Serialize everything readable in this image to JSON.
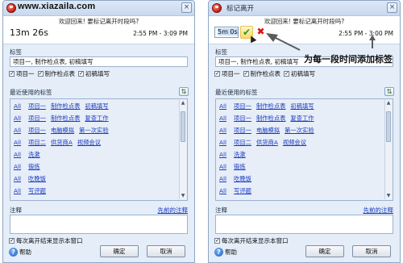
{
  "left": {
    "watermark": "www.xiazaila.com",
    "close_icon": "×",
    "header": {
      "welcome": "欢迎回来! 要标记离开时段吗?",
      "duration": "13m 26s",
      "time_range": "2:55 PM - 3:09 PM"
    },
    "tags_label": "标签",
    "tags_value": "项目一, 制作检点表, 初稿填写",
    "checkboxes": [
      {
        "label": "项目一",
        "checked": true
      },
      {
        "label": "制作检点表",
        "checked": true
      },
      {
        "label": "初稿填写",
        "checked": true
      }
    ],
    "recent_label": "最近使用的标签",
    "recent_rows": [
      {
        "all": "All",
        "tags": [
          "项目一",
          "制作检点表",
          "初稿填写"
        ]
      },
      {
        "all": "All",
        "tags": [
          "项目一",
          "制作检点表",
          "复查工作"
        ]
      },
      {
        "all": "All",
        "tags": [
          "项目一",
          "电脑模拟",
          "第一次实验"
        ]
      },
      {
        "all": "All",
        "tags": [
          "项目二",
          "供货商A",
          "视频会议"
        ]
      },
      {
        "all": "All",
        "tags": [
          "洗漱"
        ]
      },
      {
        "all": "All",
        "tags": [
          "锻炼"
        ]
      },
      {
        "all": "All",
        "tags": [
          "吃晚饭"
        ]
      },
      {
        "all": "All",
        "tags": [
          "写评题"
        ]
      }
    ],
    "note_label": "注释",
    "prev_note": "先前的注释",
    "show_window_label": "每次离开结束显示本窗口",
    "help_label": "帮助",
    "ok_label": "确定",
    "cancel_label": "取消"
  },
  "right": {
    "title": "标记离开",
    "close_icon": "×",
    "header": {
      "welcome": "欢迎回来! 要标记离开时段吗?",
      "duration_value": "5m 0s",
      "time_range": "2:55 PM - 3:00 PM"
    },
    "tags_label": "标签",
    "tags_value": "项目一, 制作检点表, 初稿填写",
    "checkboxes": [
      {
        "label": "项目一",
        "checked": true
      },
      {
        "label": "制作检点表",
        "checked": true
      },
      {
        "label": "初稿填写",
        "checked": true
      }
    ],
    "recent_label": "最近使用的标签",
    "recent_rows": [
      {
        "all": "All",
        "tags": [
          "项目一",
          "制作检点表",
          "初稿填写"
        ]
      },
      {
        "all": "All",
        "tags": [
          "项目一",
          "制作检点表",
          "复查工作"
        ]
      },
      {
        "all": "All",
        "tags": [
          "项目一",
          "电脑模拟",
          "第一次实验"
        ]
      },
      {
        "all": "All",
        "tags": [
          "项目二",
          "供货商A",
          "视频会议"
        ]
      },
      {
        "all": "All",
        "tags": [
          "洗漱"
        ]
      },
      {
        "all": "All",
        "tags": [
          "锻炼"
        ]
      },
      {
        "all": "All",
        "tags": [
          "吃晚饭"
        ]
      },
      {
        "all": "All",
        "tags": [
          "写评题"
        ]
      }
    ],
    "note_label": "注释",
    "prev_note": "先前的注释",
    "show_window_label": "每次离开结束显示本窗口",
    "help_label": "帮助",
    "ok_label": "确定",
    "cancel_label": "取消"
  },
  "annotation": "为每一段时间添加标签",
  "icons": {
    "app": "stopwatch-icon",
    "ok": "green-checkmark-icon",
    "cancel": "red-x-icon",
    "pin": "pin-icon",
    "help": "help-icon"
  }
}
